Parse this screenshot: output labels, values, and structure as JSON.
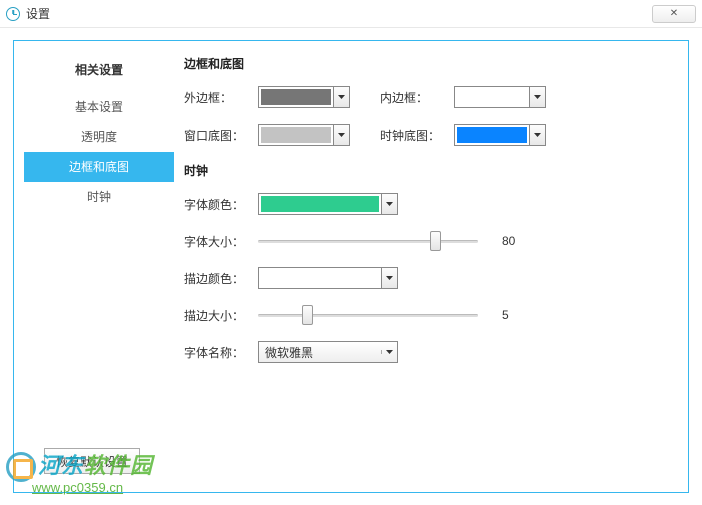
{
  "window": {
    "title": "设置"
  },
  "sidebar": {
    "title": "相关设置",
    "items": [
      "基本设置",
      "透明度",
      "边框和底图",
      "时钟"
    ],
    "active": 2
  },
  "sections": {
    "border": {
      "title": "边框和底图",
      "outer_label": "外边框：",
      "outer_color": "#767676",
      "inner_label": "内边框：",
      "inner_color": "#ffffff",
      "winbg_label": "窗口底图：",
      "winbg_color": "#c3c3c3",
      "clockbg_label": "时钟底图：",
      "clockbg_color": "#0a84ff"
    },
    "clock": {
      "title": "时钟",
      "font_color_label": "字体颜色：",
      "font_color": "#2ecc8f",
      "font_size_label": "字体大小：",
      "font_size": 80,
      "stroke_color_label": "描边颜色：",
      "stroke_color": "#ffffff",
      "stroke_size_label": "描边大小：",
      "stroke_size": 5,
      "font_name_label": "字体名称：",
      "font_name": "微软雅黑"
    }
  },
  "buttons": {
    "reset": "恢复默认设置",
    "close": "✕"
  },
  "watermark": {
    "line1a": "河东",
    "line1b": "软件园",
    "line2": "www.pc0359.cn"
  }
}
